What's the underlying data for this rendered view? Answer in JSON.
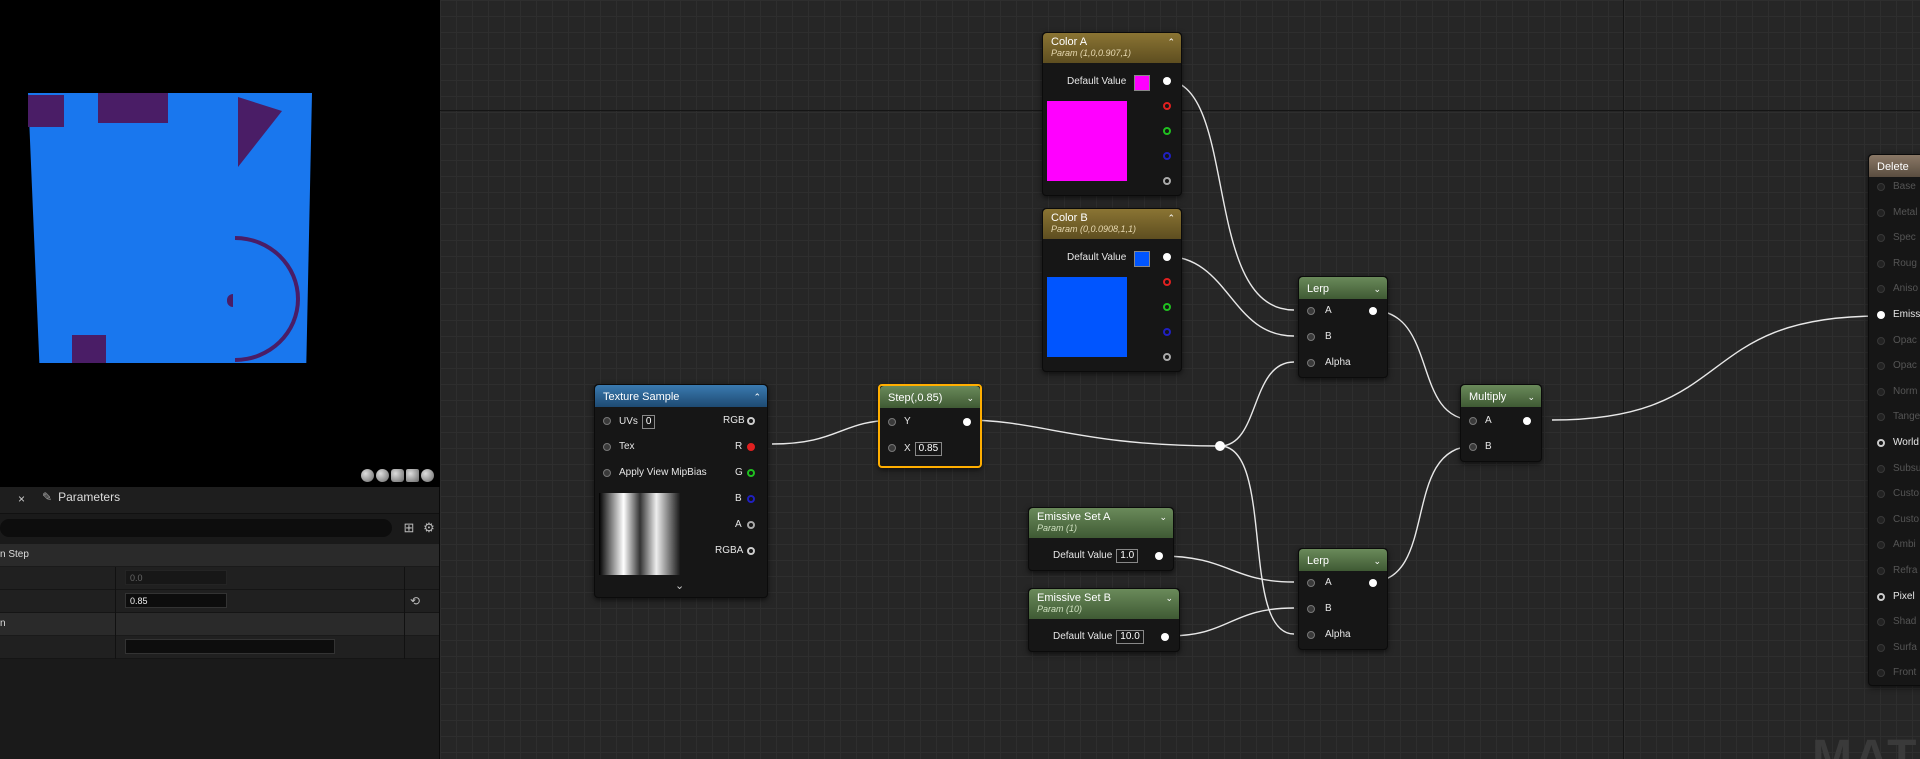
{
  "viewport": {
    "toolbar_icons": [
      "sphere-icon",
      "sphere-icon",
      "cylinder-icon",
      "cube-icon",
      "teapot-icon"
    ]
  },
  "details": {
    "tab_close": "×",
    "tab_label": "Parameters",
    "category_1": "n Step",
    "row1_value": "0.0",
    "row2_value": "0.85",
    "category_2": "n",
    "row3_value": "",
    "reset_icon": "⟲",
    "table_icon": "⊞",
    "gear_icon": "⚙"
  },
  "colors": {
    "color_a": "#ff00ff",
    "color_b": "#0055ff",
    "step_highlight": "#ffae00"
  },
  "nodes": {
    "color_a": {
      "title": "Color A",
      "subtitle": "Param (1,0,0.907,1)",
      "default_label": "Default Value"
    },
    "color_b": {
      "title": "Color B",
      "subtitle": "Param (0,0.0908,1,1)",
      "default_label": "Default Value"
    },
    "lerp1": {
      "title": "Lerp",
      "pin_a": "A",
      "pin_b": "B",
      "pin_alpha": "Alpha"
    },
    "lerp2": {
      "title": "Lerp",
      "pin_a": "A",
      "pin_b": "B",
      "pin_alpha": "Alpha"
    },
    "multiply": {
      "title": "Multiply",
      "pin_a": "A",
      "pin_b": "B"
    },
    "texture": {
      "title": "Texture Sample",
      "uvs": "UVs",
      "uvs_value": "0",
      "tex": "Tex",
      "mip": "Apply View MipBias",
      "rgb": "RGB",
      "r": "R",
      "g": "G",
      "b": "B",
      "a": "A",
      "rgba": "RGBA"
    },
    "step": {
      "title": "Step(,0.85)",
      "y": "Y",
      "x": "X",
      "x_value": "0.85"
    },
    "emissive_a": {
      "title": "Emissive Set A",
      "subtitle": "Param (1)",
      "default_label": "Default Value",
      "value": "1.0"
    },
    "emissive_b": {
      "title": "Emissive Set B",
      "subtitle": "Param (10)",
      "default_label": "Default Value",
      "value": "10.0"
    },
    "delete": {
      "title": "Delete",
      "inputs": [
        "Base",
        "Metal",
        "Spec",
        "Roug",
        "Aniso",
        "Emiss",
        "Opac",
        "Opac",
        "Norm",
        "Tange",
        "World",
        "Subsu",
        "Custo",
        "Custo",
        "Ambi",
        "Refra",
        "Pixel",
        "Shad",
        "Surfa",
        "Front"
      ]
    }
  },
  "watermark": "MATE"
}
